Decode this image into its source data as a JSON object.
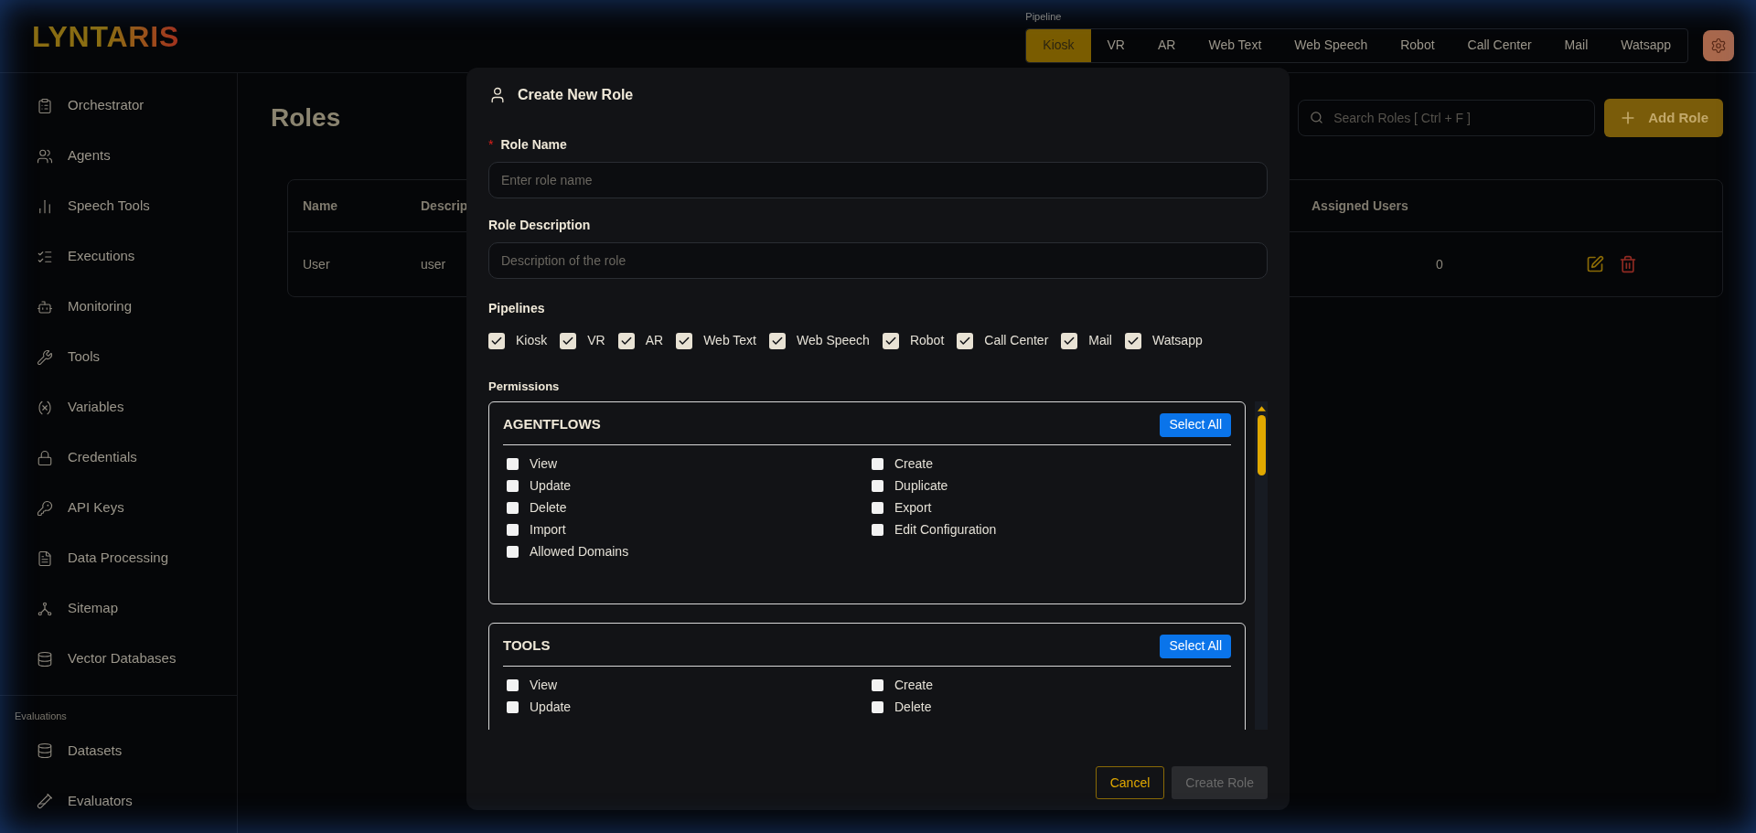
{
  "header": {
    "logo": "LYNTARIS",
    "pipeline": {
      "label": "Pipeline",
      "tabs": [
        {
          "label": "Kiosk",
          "selected": true
        },
        {
          "label": "VR",
          "selected": false
        },
        {
          "label": "AR",
          "selected": false
        },
        {
          "label": "Web Text",
          "selected": false
        },
        {
          "label": "Web Speech",
          "selected": false
        },
        {
          "label": "Robot",
          "selected": false
        },
        {
          "label": "Call Center",
          "selected": false
        },
        {
          "label": "Mail",
          "selected": false
        },
        {
          "label": "Watsapp",
          "selected": false
        }
      ]
    }
  },
  "sidebar": {
    "items": [
      {
        "label": "Orchestrator"
      },
      {
        "label": "Agents"
      },
      {
        "label": "Speech Tools"
      },
      {
        "label": "Executions"
      },
      {
        "label": "Monitoring"
      },
      {
        "label": "Tools"
      },
      {
        "label": "Variables"
      },
      {
        "label": "Credentials"
      },
      {
        "label": "API Keys"
      },
      {
        "label": "Data Processing"
      },
      {
        "label": "Sitemap"
      },
      {
        "label": "Vector Databases"
      }
    ],
    "sections": [
      {
        "title": "Evaluations",
        "items": [
          {
            "label": "Datasets"
          },
          {
            "label": "Evaluators"
          }
        ]
      }
    ]
  },
  "page": {
    "title": "Roles",
    "search": {
      "placeholder": "Search Roles [ Ctrl + F ]"
    },
    "add_button": "Add Role",
    "table": {
      "columns": [
        "Name",
        "Descrip",
        "Assigned Users"
      ],
      "rows": [
        {
          "name": "User",
          "description": "user",
          "assigned_users": "0"
        }
      ]
    }
  },
  "modal": {
    "title": "Create New Role",
    "role_name": {
      "label": "Role Name",
      "required_mark": "*",
      "placeholder": "Enter role name"
    },
    "role_description": {
      "label": "Role Description",
      "placeholder": "Description of the role"
    },
    "pipelines": {
      "label": "Pipelines",
      "options": [
        {
          "label": "Kiosk",
          "checked": true
        },
        {
          "label": "VR",
          "checked": true
        },
        {
          "label": "AR",
          "checked": true
        },
        {
          "label": "Web Text",
          "checked": true
        },
        {
          "label": "Web Speech",
          "checked": true
        },
        {
          "label": "Robot",
          "checked": true
        },
        {
          "label": "Call Center",
          "checked": true
        },
        {
          "label": "Mail",
          "checked": true
        },
        {
          "label": "Watsapp",
          "checked": true
        }
      ]
    },
    "permissions": {
      "label": "Permissions",
      "groups": [
        {
          "title": "AGENTFLOWS",
          "select_all": "Select All",
          "items": [
            {
              "label": "View",
              "checked": false
            },
            {
              "label": "Create",
              "checked": false
            },
            {
              "label": "Update",
              "checked": false
            },
            {
              "label": "Duplicate",
              "checked": false
            },
            {
              "label": "Delete",
              "checked": false
            },
            {
              "label": "Export",
              "checked": false
            },
            {
              "label": "Import",
              "checked": false
            },
            {
              "label": "Edit Configuration",
              "checked": false
            },
            {
              "label": "Allowed Domains",
              "checked": false
            }
          ]
        },
        {
          "title": "TOOLS",
          "select_all": "Select All",
          "items": [
            {
              "label": "View",
              "checked": false
            },
            {
              "label": "Create",
              "checked": false
            },
            {
              "label": "Update",
              "checked": false
            },
            {
              "label": "Delete",
              "checked": false
            }
          ]
        }
      ]
    },
    "buttons": {
      "cancel": "Cancel",
      "create": {
        "label": "Create Role",
        "disabled": true
      }
    }
  }
}
